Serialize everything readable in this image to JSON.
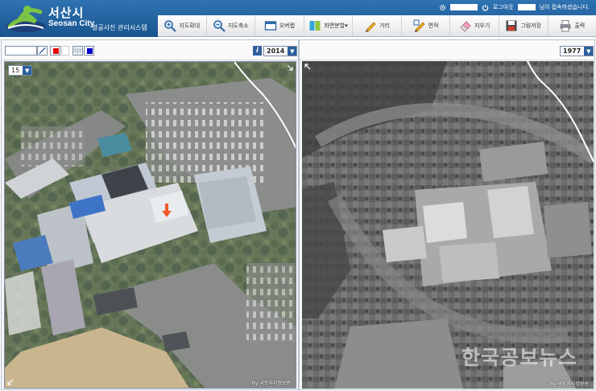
{
  "app": {
    "logo_ko": "서산시",
    "logo_en": "Seosan City",
    "system_name": "항공사진 관리시스템"
  },
  "userbar": {
    "logout_label": "로그아웃",
    "greeting": "님이 접속하셨습니다."
  },
  "toolbar": {
    "items": [
      {
        "label": "지도확대",
        "icon": "zoom-in-icon"
      },
      {
        "label": "지도축소",
        "icon": "zoom-out-icon"
      },
      {
        "label": "오버랩",
        "icon": "overlap-icon"
      },
      {
        "label": "화면분할▾",
        "icon": "split-screen-icon"
      },
      {
        "label": "거리",
        "icon": "distance-icon"
      },
      {
        "label": "면적",
        "icon": "area-icon"
      },
      {
        "label": "지우기",
        "icon": "eraser-icon"
      },
      {
        "label": "그림저장",
        "icon": "save-image-icon"
      },
      {
        "label": "출력",
        "icon": "print-icon"
      }
    ]
  },
  "left_pane": {
    "year": "2014",
    "zoom_level": "15",
    "credit": "By 국토지리정보원",
    "colors": {
      "stroke": "#e00000",
      "fill": "#0000cc"
    }
  },
  "right_pane": {
    "year": "1977",
    "credit": "By 국토지리정보원",
    "watermark": "한국공보뉴스"
  },
  "colors": {
    "header": "#1f5d9c",
    "accent": "#2e5f9c",
    "marker": "#f05a28"
  }
}
